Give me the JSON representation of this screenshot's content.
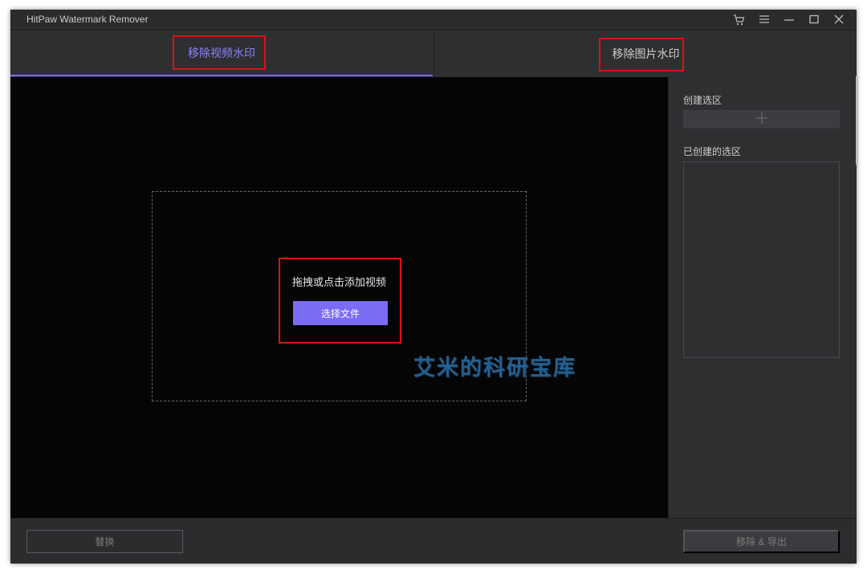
{
  "window": {
    "title": "HitPaw Watermark Remover"
  },
  "icons": {
    "cart": "cart-icon",
    "menu": "menu-icon",
    "minimize": "minimize-icon",
    "maximize": "maximize-icon",
    "close": "close-icon",
    "plus": "plus-icon"
  },
  "tabs": [
    {
      "label": "移除视频水印",
      "active": true
    },
    {
      "label": "移除图片水印",
      "active": false
    }
  ],
  "preview": {
    "drop_hint": "拖拽或点击添加视频",
    "choose_file_label": "选择文件",
    "watermark_text": "艾米的科研宝库"
  },
  "sidebar": {
    "create_region_label": "创建选区",
    "created_regions_label": "已创建的选区"
  },
  "bottom": {
    "replace_label": "替换",
    "export_label": "移除 & 导出"
  },
  "colors": {
    "accent": "#7b6cf6",
    "highlight_box": "#e01010",
    "background": "#2b2c2e",
    "preview": "#050505"
  }
}
